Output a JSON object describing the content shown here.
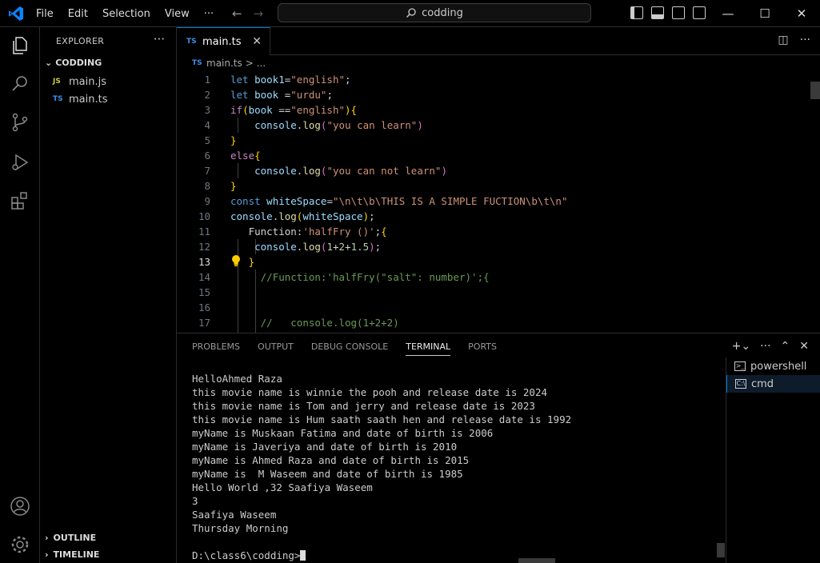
{
  "app": {
    "menu": [
      "File",
      "Edit",
      "Selection",
      "View",
      "···"
    ],
    "search_text": "codding"
  },
  "sidebar": {
    "title": "EXPLORER",
    "more": "···",
    "folder": "CODDING",
    "files": [
      {
        "type": "JS",
        "name": "main.js"
      },
      {
        "type": "TS",
        "name": "main.ts"
      }
    ],
    "outline": "OUTLINE",
    "timeline": "TIMELINE"
  },
  "editor": {
    "tab_type": "TS",
    "tab_name": "main.ts",
    "breadcrumb_type": "TS",
    "breadcrumb_file": "main.ts",
    "breadcrumb_rest": "> ...",
    "current_line": 13
  },
  "code_lines": [
    {
      "n": "1"
    },
    {
      "n": "2"
    },
    {
      "n": "3"
    },
    {
      "n": "4"
    },
    {
      "n": "5"
    },
    {
      "n": "6"
    },
    {
      "n": "7"
    },
    {
      "n": "8"
    },
    {
      "n": "9"
    },
    {
      "n": "10"
    },
    {
      "n": "11"
    },
    {
      "n": "12"
    },
    {
      "n": "13"
    },
    {
      "n": "14"
    },
    {
      "n": "15"
    },
    {
      "n": "16"
    },
    {
      "n": "17"
    }
  ],
  "panel": {
    "tabs": [
      "PROBLEMS",
      "OUTPUT",
      "DEBUG CONSOLE",
      "TERMINAL",
      "PORTS"
    ],
    "active_tab": "TERMINAL",
    "terminal_lines": [
      "HelloAhmed Raza",
      "this movie name is winnie the pooh and release date is 2024",
      "this movie name is Tom and jerry and release date is 2023",
      "this movie name is Hum saath saath hen and release date is 1992",
      "myName is Muskaan Fatima and date of birth is 2006",
      "myName is Javeriya and date of birth is 2010",
      "myName is Ahmed Raza and date of birth is 2015",
      "myName is  M Waseem and date of birth is 1985",
      "Hello World ,32 Saafiya Waseem",
      "3",
      "Saafiya Waseem",
      "Thursday Morning",
      "",
      "D:\\class6\\codding>"
    ],
    "terminals": [
      "powershell",
      "cmd"
    ],
    "active_terminal": "cmd"
  }
}
